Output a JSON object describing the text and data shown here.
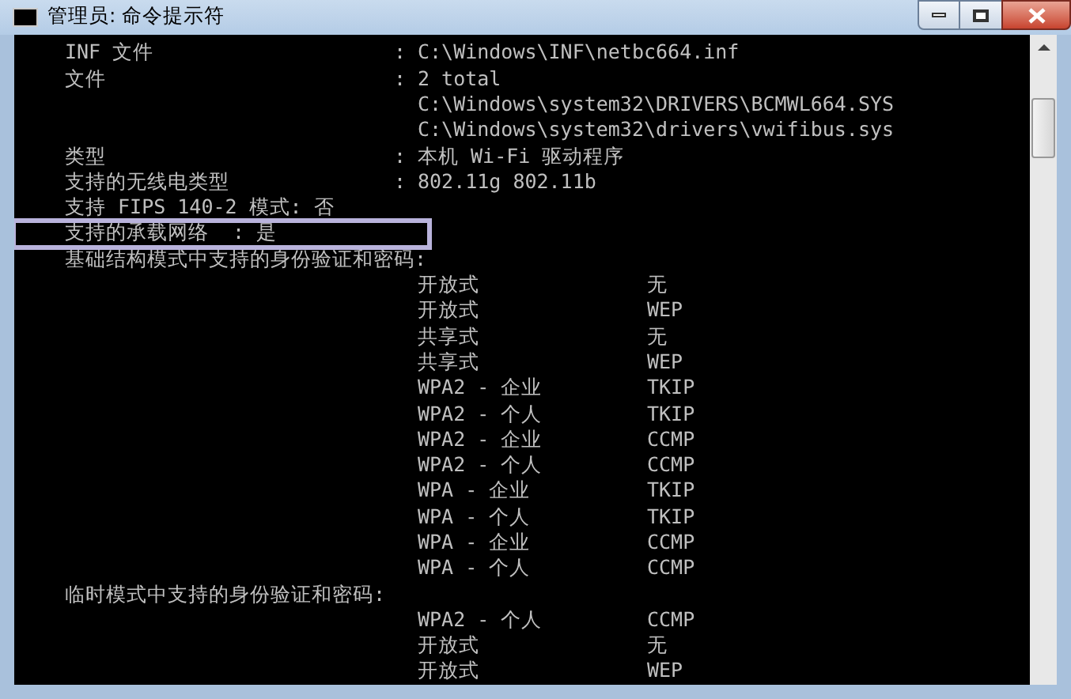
{
  "window": {
    "title": "管理员: 命令提示符"
  },
  "lines": [
    {
      "kind": "kv",
      "label": "INF 文件",
      "sep": ":",
      "value": "C:\\Windows\\INF\\netbc664.inf",
      "highlighted": false
    },
    {
      "kind": "kv",
      "label": "文件",
      "sep": ":",
      "value": "2 total",
      "highlighted": false
    },
    {
      "kind": "cont",
      "value": "C:\\Windows\\system32\\DRIVERS\\BCMWL664.SYS",
      "highlighted": false
    },
    {
      "kind": "cont",
      "value": "C:\\Windows\\system32\\drivers\\vwifibus.sys",
      "highlighted": false
    },
    {
      "kind": "kv",
      "label": "类型",
      "sep": ":",
      "value": "本机 Wi-Fi 驱动程序",
      "highlighted": false
    },
    {
      "kind": "kv",
      "label": "支持的无线电类型",
      "sep": ":",
      "value": "802.11g 802.11b",
      "highlighted": false
    },
    {
      "kind": "text",
      "text": "支持 FIPS 140-2 模式: 否",
      "highlighted": false
    },
    {
      "kind": "text",
      "text": "支持的承载网络  : 是",
      "highlighted": true
    },
    {
      "kind": "heading",
      "text": "基础结构模式中支持的身份验证和密码:",
      "highlighted": false
    },
    {
      "kind": "auth",
      "method": "开放式",
      "cipher": "无",
      "highlighted": false
    },
    {
      "kind": "auth",
      "method": "开放式",
      "cipher": "WEP",
      "highlighted": false
    },
    {
      "kind": "auth",
      "method": "共享式",
      "cipher": "无",
      "highlighted": false
    },
    {
      "kind": "auth",
      "method": "共享式",
      "cipher": "WEP",
      "highlighted": false
    },
    {
      "kind": "auth",
      "method": "WPA2 - 企业",
      "cipher": "TKIP",
      "highlighted": false
    },
    {
      "kind": "auth",
      "method": "WPA2 - 个人",
      "cipher": "TKIP",
      "highlighted": false
    },
    {
      "kind": "auth",
      "method": "WPA2 - 企业",
      "cipher": "CCMP",
      "highlighted": false
    },
    {
      "kind": "auth",
      "method": "WPA2 - 个人",
      "cipher": "CCMP",
      "highlighted": false
    },
    {
      "kind": "auth",
      "method": "WPA - 企业",
      "cipher": "TKIP",
      "highlighted": false
    },
    {
      "kind": "auth",
      "method": "WPA - 个人",
      "cipher": "TKIP",
      "highlighted": false
    },
    {
      "kind": "auth",
      "method": "WPA - 企业",
      "cipher": "CCMP",
      "highlighted": false
    },
    {
      "kind": "auth",
      "method": "WPA - 个人",
      "cipher": "CCMP",
      "highlighted": false
    },
    {
      "kind": "heading",
      "text": "临时模式中支持的身份验证和密码:",
      "highlighted": false
    },
    {
      "kind": "auth",
      "method": "WPA2 - 个人",
      "cipher": "CCMP",
      "highlighted": false
    },
    {
      "kind": "auth",
      "method": "开放式",
      "cipher": "无",
      "highlighted": false
    },
    {
      "kind": "auth",
      "method": "开放式",
      "cipher": "WEP",
      "highlighted": false
    }
  ]
}
